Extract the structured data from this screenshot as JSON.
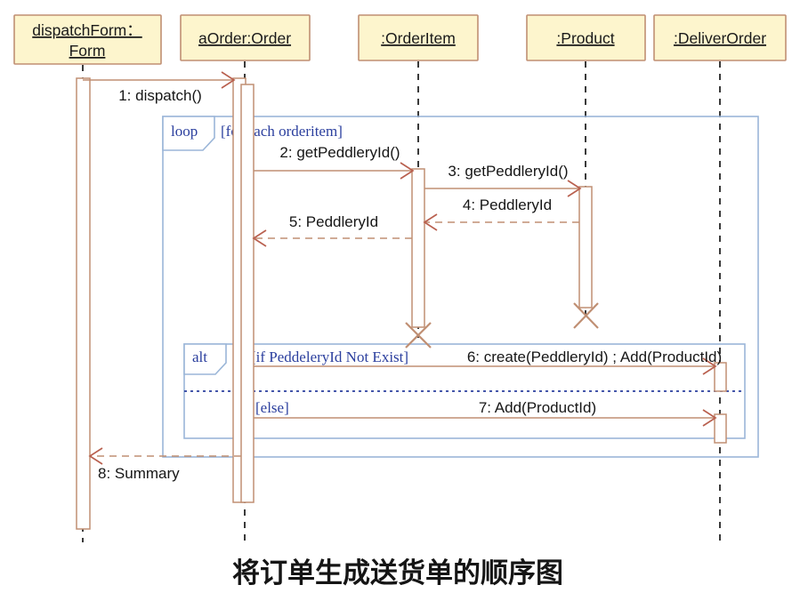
{
  "diagram": {
    "kind": "uml-sequence-diagram",
    "caption": "将订单生成送货单的顺序图",
    "colors": {
      "lifeline_box_fill": "#fdf5cd",
      "lifeline_box_stroke": "#c08f73",
      "message_line": "#c08f73",
      "arrow_head": "#b9604f",
      "frame_border": "#9bb6d8",
      "frame_text": "#2b3f9e",
      "label_text": "#161616"
    },
    "lifelines": [
      {
        "id": "dispatchForm",
        "label_line1": "dispatchForm：",
        "label_line2": "Form",
        "label": "dispatchForm：Form"
      },
      {
        "id": "aOrder",
        "label_line1": "aOrder:Order",
        "label_line2": "",
        "label": "aOrder:Order"
      },
      {
        "id": "orderItem",
        "label_line1": ":OrderItem",
        "label_line2": "",
        "label": ":OrderItem"
      },
      {
        "id": "product",
        "label_line1": ":Product",
        "label_line2": "",
        "label": ":Product"
      },
      {
        "id": "deliverOrder",
        "label_line1": ":DeliverOrder",
        "label_line2": "",
        "label": ":DeliverOrder"
      }
    ],
    "messages": [
      {
        "seq": "1",
        "text": "1: dispatch()",
        "from": "dispatchForm",
        "to": "aOrder",
        "style": "solid"
      },
      {
        "seq": "2",
        "text": "2: getPeddleryId()",
        "from": "aOrder",
        "to": "orderItem",
        "style": "solid"
      },
      {
        "seq": "3",
        "text": "3: getPeddleryId()",
        "from": "orderItem",
        "to": "product",
        "style": "solid"
      },
      {
        "seq": "4",
        "text": "4: PeddleryId",
        "from": "product",
        "to": "orderItem",
        "style": "dashed"
      },
      {
        "seq": "5",
        "text": "5: PeddleryId",
        "from": "orderItem",
        "to": "aOrder",
        "style": "dashed"
      },
      {
        "seq": "6",
        "text": "6: create(PeddleryId) ; Add(ProductId)",
        "from": "aOrder",
        "to": "deliverOrder",
        "style": "solid"
      },
      {
        "seq": "7",
        "text": "7: Add(ProductId)",
        "from": "aOrder",
        "to": "deliverOrder",
        "style": "solid"
      },
      {
        "seq": "8",
        "text": "8: Summary",
        "from": "aOrder",
        "to": "dispatchForm",
        "style": "dashed"
      }
    ],
    "fragments": [
      {
        "id": "loop-fragment",
        "operator": "loop",
        "guards": [
          "[for each orderitem]"
        ]
      },
      {
        "id": "alt-fragment",
        "operator": "alt",
        "guards": [
          "[if PeddeleryId Not Exist]",
          "[else]"
        ]
      }
    ],
    "destructions": [
      {
        "lifeline": "orderItem"
      },
      {
        "lifeline": "product"
      }
    ]
  }
}
